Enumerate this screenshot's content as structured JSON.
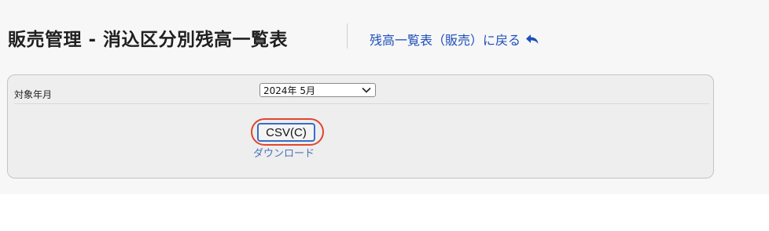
{
  "header": {
    "title": "販売管理 - 消込区分別残高一覧表",
    "back_link_label": "残高一覧表（販売）に戻る"
  },
  "form": {
    "target_month_label": "対象年月",
    "target_month_value": "2024年 5月"
  },
  "actions": {
    "csv_button_label": "CSV(C)",
    "download_label": "ダウンロード"
  },
  "colors": {
    "link": "#1e4fb8",
    "highlight": "#e0452b",
    "button_border": "#3a6bc9"
  },
  "icons": {
    "back": "reply-arrow-icon",
    "select": "chevron-down-icon"
  }
}
